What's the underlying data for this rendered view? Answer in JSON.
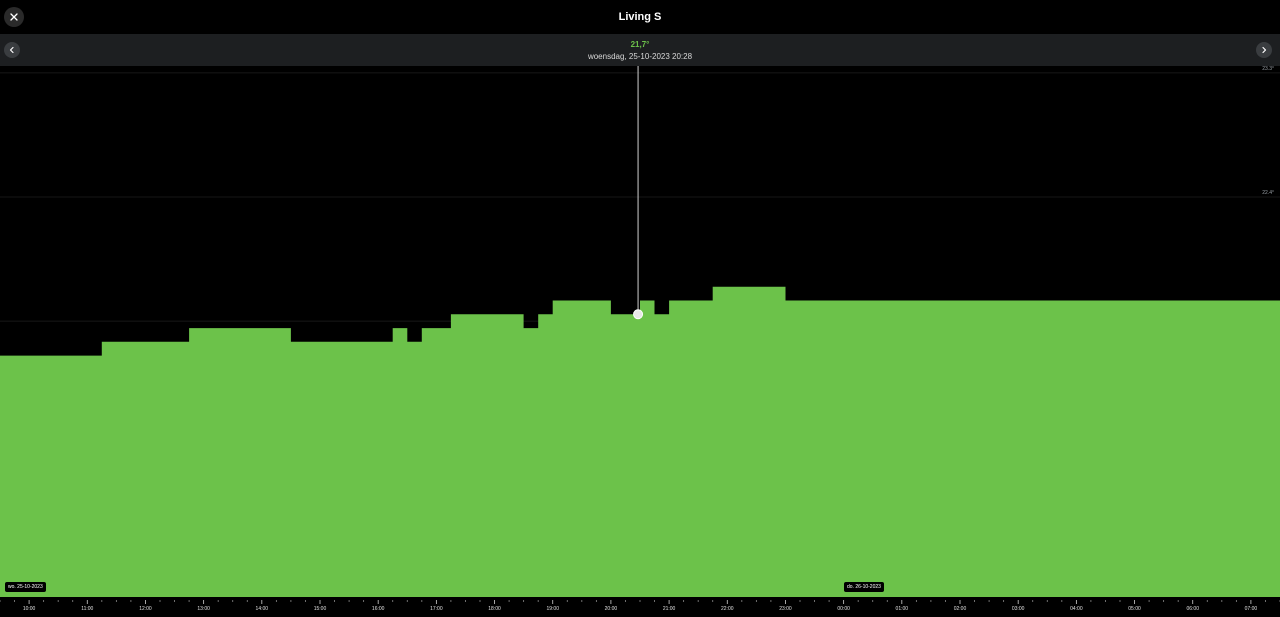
{
  "header": {
    "title": "Living S"
  },
  "readout": {
    "value": "21,7°",
    "datetime": "woensdag, 25-10-2023 20:28"
  },
  "icons": {
    "close": "close-icon",
    "prev": "chevron-left-icon",
    "next": "chevron-right-icon"
  },
  "colors": {
    "fill": "#6cc24a",
    "background": "#000000",
    "toolbar": "#1d1f21"
  },
  "chart_data": {
    "type": "area",
    "step": true,
    "x": [
      "09:30",
      "11:15",
      "12:45",
      "14:30",
      "16:15",
      "16:30",
      "16:45",
      "17:15",
      "18:30",
      "18:45",
      "19:00",
      "20:00",
      "20:30",
      "20:45",
      "21:00",
      "21:45",
      "23:00",
      "00:45",
      "07:30"
    ],
    "y": [
      21.25,
      21.35,
      21.45,
      21.35,
      21.45,
      21.35,
      21.45,
      21.55,
      21.45,
      21.55,
      21.65,
      21.55,
      21.65,
      21.55,
      21.65,
      21.75,
      21.65,
      21.65
    ],
    "x_ticks": [
      "10:00",
      "11:00",
      "12:00",
      "13:00",
      "14:00",
      "15:00",
      "16:00",
      "17:00",
      "18:00",
      "19:00",
      "20:00",
      "21:00",
      "22:00",
      "23:00",
      "00:00",
      "01:00",
      "02:00",
      "03:00",
      "04:00",
      "05:00",
      "06:00",
      "07:00"
    ],
    "y_ticks": [
      "23.3°",
      "22.4°"
    ],
    "ylim": [
      19.5,
      23.35
    ],
    "date_labels": [
      "wo. 25-10-2023",
      "do. 26-10-2023"
    ],
    "cursor": {
      "x": "20:28",
      "y": 21.55
    },
    "grid": true
  }
}
